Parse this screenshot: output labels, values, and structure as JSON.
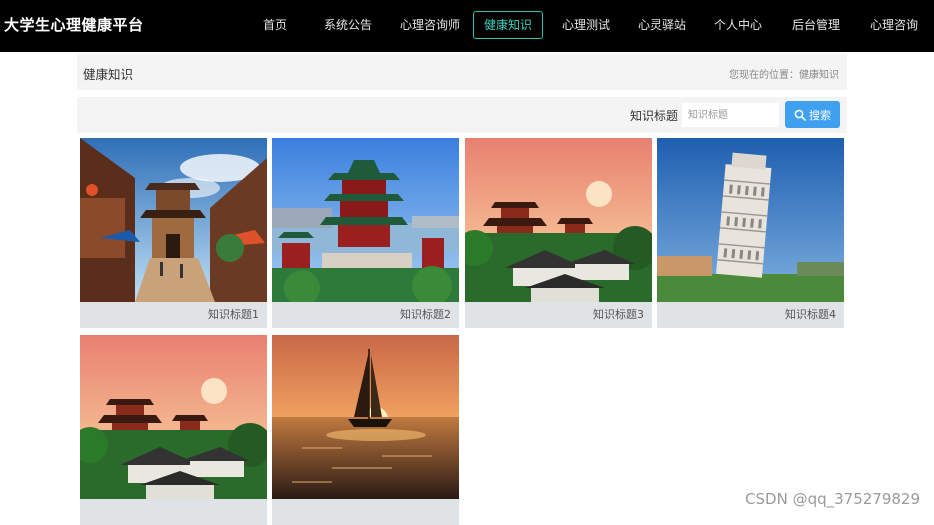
{
  "brand": "大学生心理健康平台",
  "nav": [
    {
      "label": "首页"
    },
    {
      "label": "系统公告"
    },
    {
      "label": "心理咨询师"
    },
    {
      "label": "健康知识"
    },
    {
      "label": "心理测试"
    },
    {
      "label": "心灵驿站"
    },
    {
      "label": "个人中心"
    },
    {
      "label": "后台管理"
    },
    {
      "label": "心理咨询"
    }
  ],
  "active_nav": "健康知识",
  "breadcrumb": {
    "title": "健康知识",
    "location": "您现在的位置：健康知识"
  },
  "search": {
    "label": "知识标题",
    "placeholder": "知识标题",
    "value": "",
    "button": "搜索"
  },
  "cards": [
    {
      "caption": "知识标题1",
      "image": "old-town-street-photo"
    },
    {
      "caption": "知识标题2",
      "image": "tower-pavilion-lake-photo"
    },
    {
      "caption": "知识标题3",
      "image": "chinese-temple-sunset-photo"
    },
    {
      "caption": "知识标题4",
      "image": "leaning-tower-photo"
    },
    {
      "caption": "",
      "image": "chinese-temple-sunset-photo"
    },
    {
      "caption": "",
      "image": "sailboat-sunset-photo"
    }
  ],
  "watermark": "CSDN @qq_375279829",
  "colors": {
    "accent": "#2ec4b6",
    "button": "#3fa0f0",
    "topbar": "#000000"
  }
}
